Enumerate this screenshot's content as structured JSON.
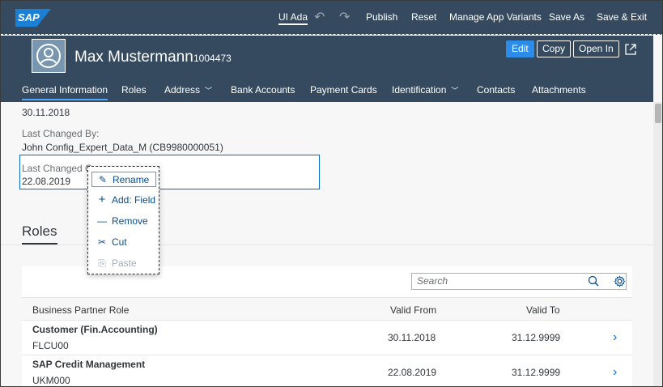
{
  "toolbar": {
    "logo": "SAP",
    "ui_adapt": "UI Adaptation",
    "publish": "Publish",
    "reset": "Reset",
    "manage_variants": "Manage App Variants",
    "save_as": "Save As",
    "save_exit": "Save & Exit"
  },
  "header": {
    "name": "Max Mustermann",
    "id": "1004473",
    "edit": "Edit",
    "copy": "Copy",
    "open_in": "Open In"
  },
  "tabs": [
    {
      "label": "General Information"
    },
    {
      "label": "Roles"
    },
    {
      "label": "Address"
    },
    {
      "label": "Bank Accounts"
    },
    {
      "label": "Payment Cards"
    },
    {
      "label": "Identification"
    },
    {
      "label": "Contacts"
    },
    {
      "label": "Attachments"
    }
  ],
  "general": {
    "date_value": "30.11.2018",
    "changed_by_label": "Last Changed By:",
    "changed_by_value": "John Config_Expert_Data_M (CB9980000051)",
    "changed_on_label": "Last Changed On:",
    "changed_on_value": "22.08.2019"
  },
  "roles": {
    "title": "Roles",
    "search_placeholder": "Search",
    "columns": [
      "Business Partner Role",
      "Valid From",
      "Valid To"
    ],
    "rows": [
      {
        "name": "Customer (Fin.Accounting)",
        "code": "FLCU00",
        "valid_from": "30.11.2018",
        "valid_to": "31.12.9999"
      },
      {
        "name": "SAP Credit Management",
        "code": "UKM000",
        "valid_from": "22.08.2019",
        "valid_to": "31.12.9999"
      }
    ]
  },
  "context_menu": {
    "items": [
      {
        "label": "Rename",
        "icon": "pencil-icon"
      },
      {
        "label": "Add: Field",
        "icon": "plus-icon"
      },
      {
        "label": "Remove",
        "icon": "minus-icon"
      },
      {
        "label": "Cut",
        "icon": "scissors-icon"
      },
      {
        "label": "Paste",
        "icon": "paste-icon"
      }
    ]
  },
  "colors": {
    "shell": "#354a5f",
    "accent": "#0a6ed1",
    "edit_button": "#2d8ce8"
  }
}
